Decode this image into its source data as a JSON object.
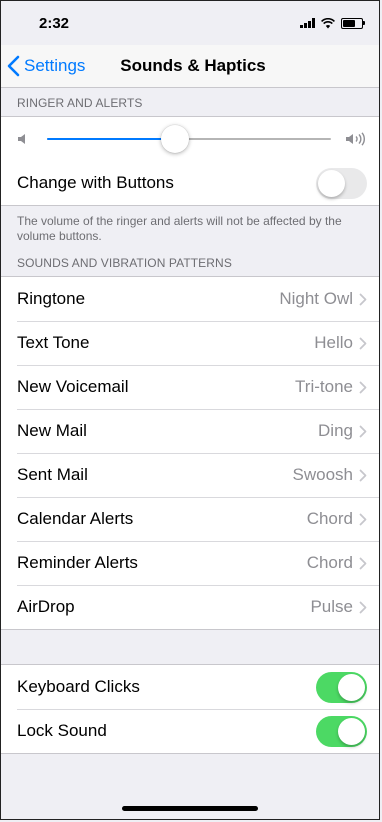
{
  "status_bar": {
    "time": "2:32",
    "battery_level": 0.68
  },
  "nav": {
    "back_label": "Settings",
    "title": "Sounds & Haptics"
  },
  "ringer": {
    "header": "RINGER AND ALERTS",
    "volume_level": 0.45,
    "change_with_buttons": {
      "label": "Change with Buttons",
      "on": false
    },
    "note": "The volume of the ringer and alerts will not be affected by the volume buttons."
  },
  "patterns": {
    "header": "SOUNDS AND VIBRATION PATTERNS",
    "items": [
      {
        "label": "Ringtone",
        "value": "Night Owl"
      },
      {
        "label": "Text Tone",
        "value": "Hello"
      },
      {
        "label": "New Voicemail",
        "value": "Tri-tone"
      },
      {
        "label": "New Mail",
        "value": "Ding"
      },
      {
        "label": "Sent Mail",
        "value": "Swoosh"
      },
      {
        "label": "Calendar Alerts",
        "value": "Chord"
      },
      {
        "label": "Reminder Alerts",
        "value": "Chord"
      },
      {
        "label": "AirDrop",
        "value": "Pulse"
      }
    ]
  },
  "toggles": [
    {
      "label": "Keyboard Clicks",
      "on": true
    },
    {
      "label": "Lock Sound",
      "on": true
    }
  ],
  "colors": {
    "accent": "#007aff",
    "toggle_on": "#4cd964",
    "background": "#efeff4"
  },
  "icons": [
    "signal-icon",
    "wifi-icon",
    "battery-icon",
    "back-chevron-icon",
    "volume-low-icon",
    "volume-high-icon",
    "chevron-right-icon"
  ]
}
